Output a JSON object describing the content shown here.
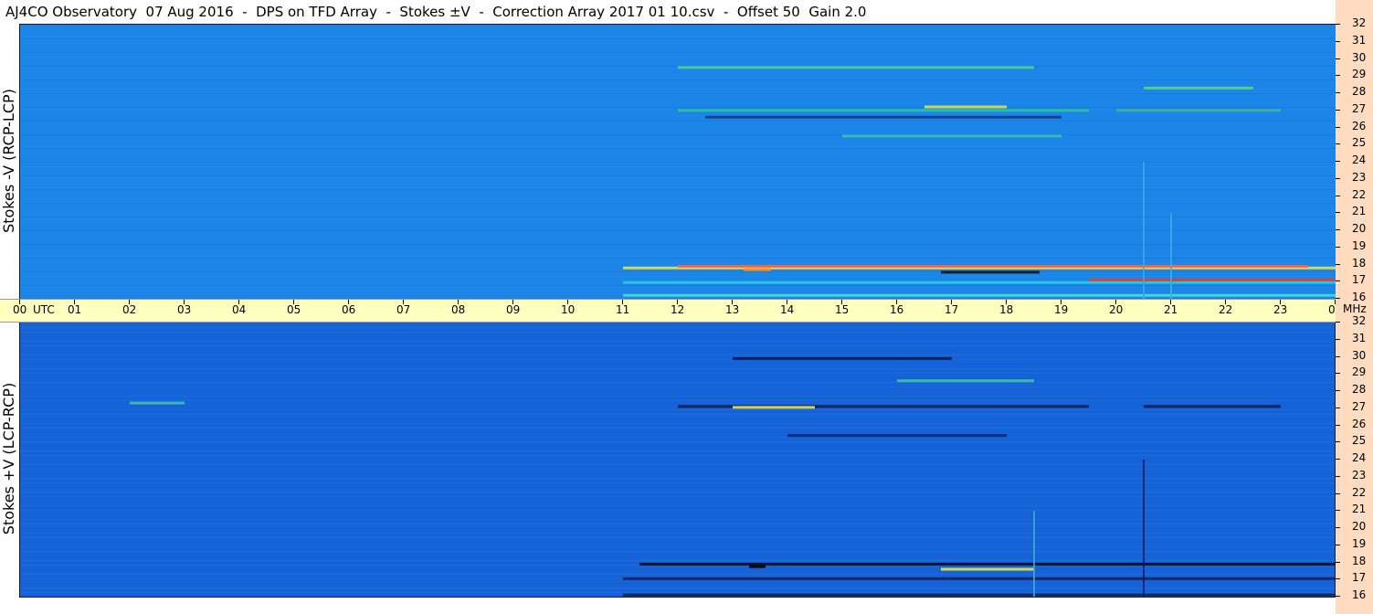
{
  "title": "AJ4CO Observatory  07 Aug 2016  -  DPS on TFD Array  -  Stokes ±V  -  Correction Array 2017 01 10.csv  -  Offset 50  Gain 2.0",
  "chart_data": {
    "type": "heatmap",
    "colormap": "blue-cyan-yellow-red",
    "x_axis": {
      "unit_label": "UTC",
      "range_hours": [
        0,
        24
      ],
      "ticks": [
        "00",
        "01",
        "02",
        "03",
        "04",
        "05",
        "06",
        "07",
        "08",
        "09",
        "10",
        "11",
        "12",
        "13",
        "14",
        "15",
        "16",
        "17",
        "18",
        "19",
        "20",
        "21",
        "22",
        "23",
        "00"
      ]
    },
    "y_axis": {
      "unit_label": "MHz",
      "range_mhz": [
        16,
        32
      ],
      "ticks": [
        "32",
        "31",
        "30",
        "29",
        "28",
        "27",
        "26",
        "25",
        "24",
        "23",
        "22",
        "21",
        "20",
        "19",
        "18",
        "17",
        "16"
      ]
    },
    "panels": [
      {
        "id": "top",
        "ylabel": "Stokes -V (RCP-LCP)",
        "base_color": "#1c86e8",
        "features": [
          {
            "kind": "band",
            "t0": 11.0,
            "t1": 24.0,
            "f": 17.8,
            "color": "#f0e040"
          },
          {
            "kind": "band",
            "t0": 12.0,
            "t1": 23.5,
            "f": 17.9,
            "color": "#ff6040"
          },
          {
            "kind": "band",
            "t0": 13.2,
            "t1": 13.7,
            "f": 17.7,
            "color": "#ff9020"
          },
          {
            "kind": "band",
            "t0": 16.8,
            "t1": 18.6,
            "f": 17.55,
            "color": "#101020"
          },
          {
            "kind": "band",
            "t0": 11.0,
            "t1": 24.0,
            "f": 16.95,
            "color": "#20d0e0"
          },
          {
            "kind": "band",
            "t0": 19.5,
            "t1": 24.0,
            "f": 17.1,
            "color": "#e04030"
          },
          {
            "kind": "band",
            "t0": 11.0,
            "t1": 24.0,
            "f": 16.2,
            "color": "#40e0d0"
          },
          {
            "kind": "band",
            "t0": 12.0,
            "t1": 19.5,
            "f": 27.0,
            "color": "#30c0a0"
          },
          {
            "kind": "band",
            "t0": 12.5,
            "t1": 19.0,
            "f": 26.6,
            "color": "#1a3a80"
          },
          {
            "kind": "band",
            "t0": 16.5,
            "t1": 18.0,
            "f": 27.2,
            "color": "#e0e040"
          },
          {
            "kind": "band",
            "t0": 12.0,
            "t1": 18.5,
            "f": 29.5,
            "color": "#50d0a0"
          },
          {
            "kind": "band",
            "t0": 15.0,
            "t1": 19.0,
            "f": 25.5,
            "color": "#40c0b0"
          },
          {
            "kind": "band",
            "t0": 20.5,
            "t1": 22.5,
            "f": 28.3,
            "color": "#60d080"
          },
          {
            "kind": "band",
            "t0": 20.0,
            "t1": 23.0,
            "f": 27.0,
            "color": "#40b0a0"
          },
          {
            "kind": "vline",
            "t": 20.5,
            "f0": 16.0,
            "f1": 24.0,
            "color": "#40a8e0"
          },
          {
            "kind": "vline",
            "t": 21.0,
            "f0": 16.0,
            "f1": 21.0,
            "color": "#40b0d8"
          }
        ]
      },
      {
        "id": "bottom",
        "ylabel": "Stokes +V (LCP-RCP)",
        "base_color": "#1663d8",
        "features": [
          {
            "kind": "band",
            "t0": 11.3,
            "t1": 24.0,
            "f": 17.9,
            "color": "#0a0a20"
          },
          {
            "kind": "band",
            "t0": 13.3,
            "t1": 13.6,
            "f": 17.75,
            "color": "#000000"
          },
          {
            "kind": "band",
            "t0": 16.8,
            "t1": 18.5,
            "f": 17.6,
            "color": "#f0e040"
          },
          {
            "kind": "band",
            "t0": 11.0,
            "t1": 24.0,
            "f": 17.05,
            "color": "#102060"
          },
          {
            "kind": "band",
            "t0": 11.0,
            "t1": 24.0,
            "f": 16.1,
            "color": "#102050"
          },
          {
            "kind": "band",
            "t0": 12.0,
            "t1": 19.5,
            "f": 27.1,
            "color": "#0a1a50"
          },
          {
            "kind": "band",
            "t0": 13.0,
            "t1": 14.5,
            "f": 27.05,
            "color": "#f0e040"
          },
          {
            "kind": "band",
            "t0": 20.5,
            "t1": 23.0,
            "f": 27.1,
            "color": "#0a1a50"
          },
          {
            "kind": "band",
            "t0": 13.0,
            "t1": 17.0,
            "f": 29.9,
            "color": "#0a1a50"
          },
          {
            "kind": "band",
            "t0": 14.0,
            "t1": 18.0,
            "f": 25.4,
            "color": "#0a2070"
          },
          {
            "kind": "band",
            "t0": 16.0,
            "t1": 18.5,
            "f": 28.6,
            "color": "#40c0b0"
          },
          {
            "kind": "band",
            "t0": 2.0,
            "t1": 3.0,
            "f": 27.3,
            "color": "#40c0b0"
          },
          {
            "kind": "vline",
            "t": 20.5,
            "f0": 16.0,
            "f1": 24.0,
            "color": "#0a1a60"
          },
          {
            "kind": "vline",
            "t": 18.5,
            "f0": 16.0,
            "f1": 21.0,
            "color": "#40b0d0"
          },
          {
            "kind": "vline",
            "t": 24.0,
            "f0": 16.0,
            "f1": 32.0,
            "color": "#101020"
          }
        ]
      }
    ]
  }
}
